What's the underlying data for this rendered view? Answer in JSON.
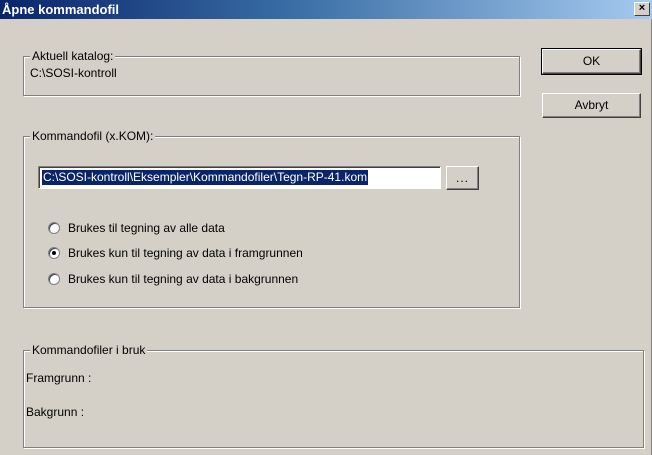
{
  "window": {
    "title": "Åpne kommandofil",
    "close_label": "×"
  },
  "current_dir": {
    "legend": "Aktuell katalog:",
    "value": "C:\\SOSI-kontroll"
  },
  "buttons": {
    "ok_label": "OK",
    "cancel_label": "Avbryt"
  },
  "command_file": {
    "legend": "Kommandofil (x.KOM):",
    "path_value": "C:\\SOSI-kontroll\\Eksempler\\Kommandofiler\\Tegn-RP-41.kom",
    "browse_label": "...",
    "options": [
      {
        "label": "Brukes til tegning av alle data",
        "selected": false
      },
      {
        "label": "Brukes kun til tegning av data i framgrunnen",
        "selected": true
      },
      {
        "label": "Brukes kun til tegning av data i bakgrunnen",
        "selected": false
      }
    ]
  },
  "in_use": {
    "legend": "Kommandofiler i bruk",
    "foreground_label": "Framgrunn :",
    "background_label": "Bakgrunn :"
  }
}
